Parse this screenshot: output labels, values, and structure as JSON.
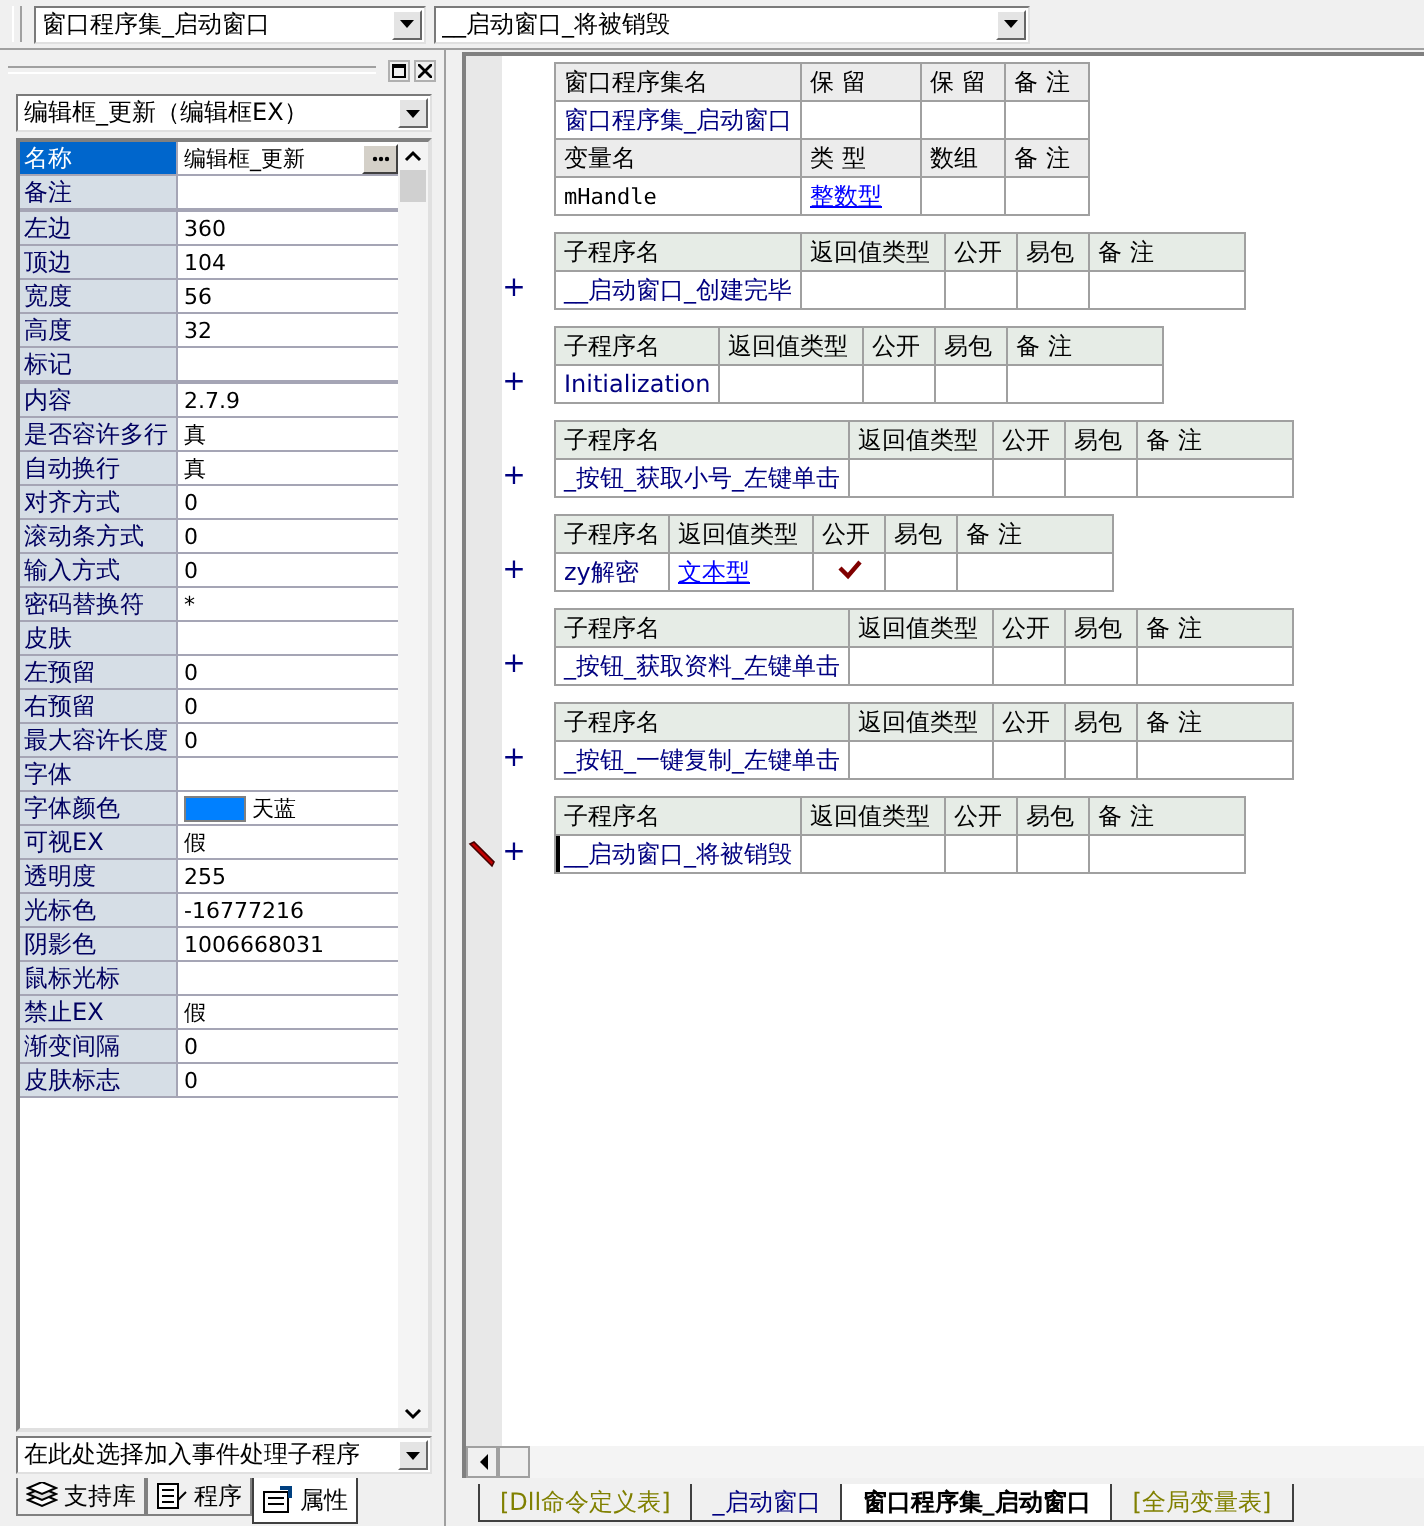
{
  "top_bar": {
    "class_combo": "窗口程序集_启动窗口",
    "method_combo": "__启动窗口_将被销毁"
  },
  "left_panel": {
    "object_combo": "编辑框_更新（编辑框EX）",
    "properties": [
      {
        "name": "名称",
        "value": "编辑框_更新",
        "selected": true,
        "group_start": false,
        "kind": "text"
      },
      {
        "name": "备注",
        "selected": false,
        "group_start": false,
        "kind": "text"
      },
      {
        "name": "左边",
        "value": "360",
        "selected": false,
        "group_start": true,
        "kind": "text"
      },
      {
        "name": "顶边",
        "value": "104",
        "selected": false,
        "group_start": false,
        "kind": "text"
      },
      {
        "name": "宽度",
        "value": "56",
        "selected": false,
        "group_start": false,
        "kind": "text"
      },
      {
        "name": "高度",
        "value": "32",
        "selected": false,
        "group_start": false,
        "kind": "text"
      },
      {
        "name": "标记",
        "selected": false,
        "group_start": false,
        "kind": "text"
      },
      {
        "name": "内容",
        "value": "2.7.9",
        "selected": false,
        "group_start": true,
        "kind": "text"
      },
      {
        "name": "是否容许多行",
        "value": "真",
        "selected": false,
        "group_start": false,
        "kind": "text"
      },
      {
        "name": "自动换行",
        "value": "真",
        "selected": false,
        "group_start": false,
        "kind": "text"
      },
      {
        "name": "对齐方式",
        "value": "0",
        "selected": false,
        "group_start": false,
        "kind": "text"
      },
      {
        "name": "滚动条方式",
        "value": "0",
        "selected": false,
        "group_start": false,
        "kind": "text"
      },
      {
        "name": "输入方式",
        "value": "0",
        "selected": false,
        "group_start": false,
        "kind": "text"
      },
      {
        "name": "密码替换符",
        "value": "*",
        "selected": false,
        "group_start": false,
        "kind": "text"
      },
      {
        "name": "皮肤",
        "selected": false,
        "group_start": false,
        "kind": "text"
      },
      {
        "name": "左预留",
        "value": "0",
        "selected": false,
        "group_start": false,
        "kind": "text"
      },
      {
        "name": "右预留",
        "value": "0",
        "selected": false,
        "group_start": false,
        "kind": "text"
      },
      {
        "name": "最大容许长度",
        "value": "0",
        "selected": false,
        "group_start": false,
        "kind": "text"
      },
      {
        "name": "字体",
        "selected": false,
        "group_start": false,
        "kind": "text"
      },
      {
        "name": "字体颜色",
        "value": "天蓝",
        "color": "#0080ff",
        "selected": false,
        "group_start": false,
        "kind": "color"
      },
      {
        "name": "可视EX",
        "value": "假",
        "selected": false,
        "group_start": false,
        "kind": "text"
      },
      {
        "name": "透明度",
        "value": "255",
        "selected": false,
        "group_start": false,
        "kind": "text"
      },
      {
        "name": "光标色",
        "value": "-16777216",
        "selected": false,
        "group_start": false,
        "kind": "text"
      },
      {
        "name": "阴影色",
        "value": "1006668031",
        "selected": false,
        "group_start": false,
        "kind": "text"
      },
      {
        "name": "鼠标光标",
        "selected": false,
        "group_start": false,
        "kind": "text"
      },
      {
        "name": "禁止EX",
        "value": "假",
        "selected": false,
        "group_start": false,
        "kind": "text"
      },
      {
        "name": "渐变间隔",
        "value": "0",
        "selected": false,
        "group_start": false,
        "kind": "text"
      },
      {
        "name": "皮肤标志",
        "value": "0",
        "selected": false,
        "group_start": false,
        "kind": "text"
      }
    ],
    "event_combo": "在此处选择加入事件处理子程序",
    "tabs": [
      {
        "label": "支持库",
        "kind": "library",
        "selected": false
      },
      {
        "label": "程序",
        "kind": "program",
        "selected": false
      },
      {
        "label": "属性",
        "kind": "properties",
        "selected": true
      }
    ]
  },
  "editor": {
    "blocks": [
      {
        "kind": "assembly",
        "header": [
          "窗口程序集名",
          "保 留",
          "保 留",
          "备 注"
        ],
        "name": "窗口程序集_启动窗口",
        "var_header": [
          "变量名",
          "类 型",
          "数组",
          "备 注"
        ],
        "variables": [
          {
            "name": "mHandle",
            "type": "整数型"
          }
        ]
      },
      {
        "kind": "subroutine",
        "header": [
          "子程序名",
          "返回值类型",
          "公开",
          "易包",
          "备 注"
        ],
        "expander": "+",
        "name": "__启动窗口_创建完毕",
        "public": false,
        "editing": false
      },
      {
        "kind": "subroutine",
        "header": [
          "子程序名",
          "返回值类型",
          "公开",
          "易包",
          "备 注"
        ],
        "expander": "+",
        "name": "Initialization",
        "public": false,
        "editing": false
      },
      {
        "kind": "subroutine",
        "header": [
          "子程序名",
          "返回值类型",
          "公开",
          "易包",
          "备 注"
        ],
        "expander": "+",
        "name": "_按钮_获取小号_左键单击",
        "public": false,
        "editing": false
      },
      {
        "kind": "subroutine",
        "header": [
          "子程序名",
          "返回值类型",
          "公开",
          "易包",
          "备 注"
        ],
        "expander": "+",
        "name": "zy解密",
        "return_type": "文本型",
        "public": true,
        "editing": false
      },
      {
        "kind": "subroutine",
        "header": [
          "子程序名",
          "返回值类型",
          "公开",
          "易包",
          "备 注"
        ],
        "expander": "+",
        "name": "_按钮_获取资料_左键单击",
        "public": false,
        "editing": false
      },
      {
        "kind": "subroutine",
        "header": [
          "子程序名",
          "返回值类型",
          "公开",
          "易包",
          "备 注"
        ],
        "expander": "+",
        "name": "_按钮_一键复制_左键单击",
        "public": false,
        "editing": false
      },
      {
        "kind": "subroutine",
        "header": [
          "子程序名",
          "返回值类型",
          "公开",
          "易包",
          "备 注"
        ],
        "expander": "+",
        "name": "__启动窗口_将被销毁",
        "public": false,
        "editing": true
      }
    ],
    "tabs": [
      {
        "label": "[Dll命令定义表]",
        "color": "#808000",
        "selected": false
      },
      {
        "label": "_启动窗口",
        "color": "#000080",
        "selected": false
      },
      {
        "label": "窗口程序集_启动窗口",
        "color": "#000000",
        "selected": true
      },
      {
        "label": "[全局变量表]",
        "color": "#808000",
        "selected": false
      }
    ]
  }
}
